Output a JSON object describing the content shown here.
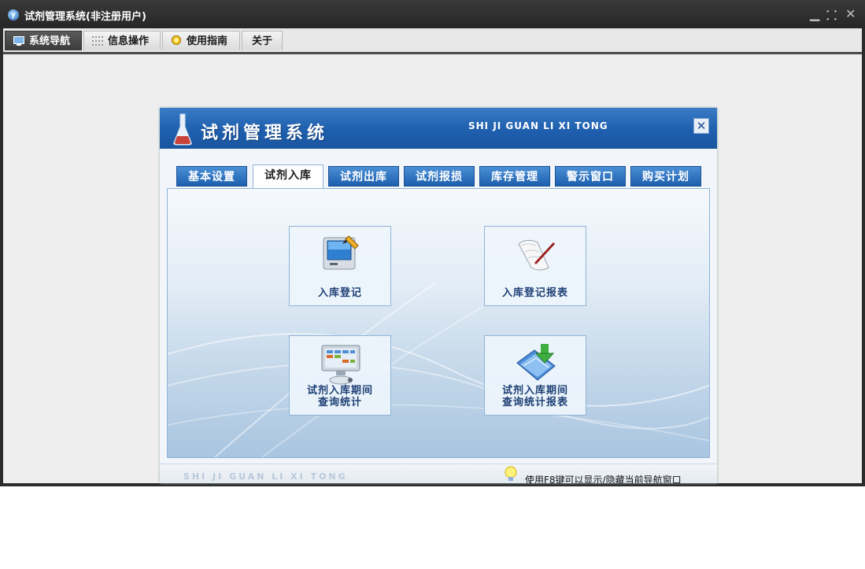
{
  "window": {
    "title": "试剂管理系统(非注册用户)",
    "app_icon_glyph": "y",
    "controls": {
      "minimize": "▁",
      "restore": "⸬",
      "close": "✕"
    }
  },
  "menu": {
    "tabs": [
      {
        "label": "系统导航",
        "icon": "monitor-icon",
        "active": true
      },
      {
        "label": "信息操作",
        "icon": "grid-icon",
        "active": false
      },
      {
        "label": "使用指南",
        "icon": "guide-icon",
        "active": false
      },
      {
        "label": "关于",
        "icon": "",
        "active": false
      }
    ]
  },
  "panel": {
    "title": "试剂管理系统",
    "subtitle": "SHI JI GUAN LI XI TONG",
    "close_label": "✕",
    "tabs": [
      {
        "label": "基本设置",
        "active": false
      },
      {
        "label": "试剂入库",
        "active": true
      },
      {
        "label": "试剂出库",
        "active": false
      },
      {
        "label": "试剂报损",
        "active": false
      },
      {
        "label": "库存管理",
        "active": false
      },
      {
        "label": "警示窗口",
        "active": false
      },
      {
        "label": "购买计划",
        "active": false
      }
    ],
    "functions": [
      {
        "label": "入库登记",
        "icon": "computer-pen-icon"
      },
      {
        "label": "入库登记报表",
        "icon": "scroll-pen-icon"
      },
      {
        "label_line1": "试剂入库期间",
        "label_line2": "查询统计",
        "icon": "computer-stats-icon"
      },
      {
        "label_line1": "试剂入库期间",
        "label_line2": "查询统计报表",
        "icon": "folder-download-icon"
      }
    ],
    "footer": {
      "brand": "SHI JI GUAN LI XI TONG",
      "hint": "使用F8键可以显示/隐藏当前导航窗口"
    }
  },
  "colors": {
    "header_blue": "#1e5fae",
    "tab_blue": "#2a6fc0",
    "window_dark": "#2b2b2b"
  }
}
